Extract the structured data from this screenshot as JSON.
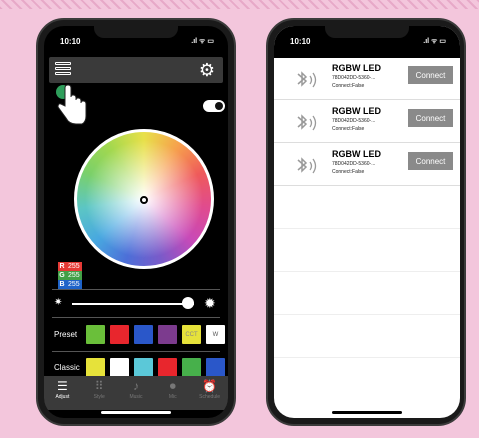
{
  "left_phone": {
    "status_time": "10:10",
    "status_icons": ".ıl ᯤ ▭",
    "rgb": [
      {
        "letter": "R",
        "value": "255",
        "color": "#e53935"
      },
      {
        "letter": "G",
        "value": "255",
        "color": "#43a047"
      },
      {
        "letter": "B",
        "value": "255",
        "color": "#1e63c9"
      }
    ],
    "toggle_on": true,
    "brightness_fraction": 0.95,
    "preset": {
      "label": "Preset",
      "swatches": [
        {
          "color": "#6abf3a",
          "text": ""
        },
        {
          "color": "#e8262d",
          "text": ""
        },
        {
          "color": "#2a57c9",
          "text": ""
        },
        {
          "color": "#7c3b8e",
          "text": ""
        },
        {
          "color": "#e6e23a",
          "text": "CCT"
        },
        {
          "color": "#ffffff",
          "text": "W"
        }
      ]
    },
    "classic": {
      "label": "Classic",
      "swatches": [
        "#e6e23a",
        "#ffffff",
        "#5bc8d8",
        "#e8262d",
        "#47b04b",
        "#2a57c9"
      ]
    },
    "tabs": [
      {
        "label": "Adjust",
        "icon": "sliders-icon",
        "glyph": "☰",
        "active": true
      },
      {
        "label": "Style",
        "icon": "grid-icon",
        "glyph": "⠿",
        "active": false
      },
      {
        "label": "Music",
        "icon": "music-icon",
        "glyph": "♪",
        "active": false
      },
      {
        "label": "Mic",
        "icon": "mic-icon",
        "glyph": "⏺",
        "active": false
      },
      {
        "label": "Schedule",
        "icon": "alarm-icon",
        "glyph": "⏰",
        "active": false
      }
    ]
  },
  "right_phone": {
    "status_time": "10:10",
    "status_icons": ".ıl ᯤ ▭",
    "devices": [
      {
        "name": "RGBW LED",
        "id": "78D042DD-5360-...",
        "status": "Connect:False",
        "button": "Connect"
      },
      {
        "name": "RGBW LED",
        "id": "78D042DD-5360-...",
        "status": "Connect:False",
        "button": "Connect"
      },
      {
        "name": "RGBW LED",
        "id": "78D042DD-5360-...",
        "status": "Connect:False",
        "button": "Connect"
      }
    ]
  }
}
